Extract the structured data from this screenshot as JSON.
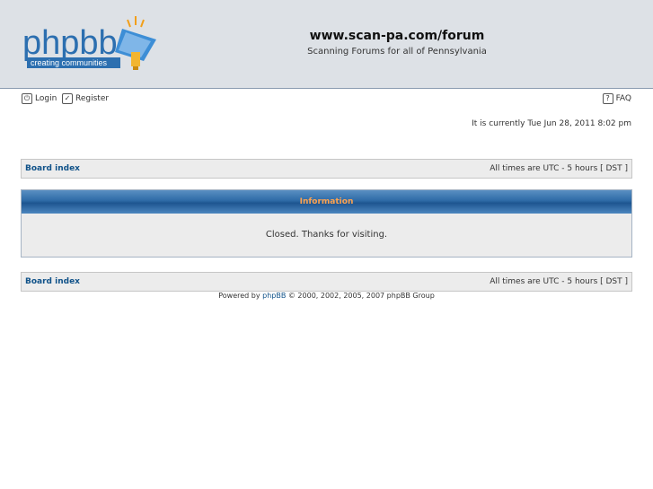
{
  "header": {
    "logo_main": "phpbb",
    "logo_sub": "creating communities",
    "site_title": "www.scan-pa.com/forum",
    "site_description": "Scanning Forums for all of Pennsylvania"
  },
  "nav": {
    "login": "Login",
    "register": "Register",
    "faq": "FAQ"
  },
  "current_time": "It is currently Tue Jun 28, 2011 8:02 pm",
  "breadcrumb": {
    "board_index": "Board index",
    "timezone": "All times are UTC - 5 hours [ DST ]"
  },
  "info": {
    "title": "Information",
    "message": "Closed. Thanks for visiting."
  },
  "footer": {
    "powered_by": "Powered by",
    "link": "phpBB",
    "copyright": "© 2000, 2002, 2005, 2007 phpBB Group"
  },
  "colors": {
    "link": "#105289",
    "header_bg": "#dde1e6",
    "info_title": "#ffa34f"
  }
}
